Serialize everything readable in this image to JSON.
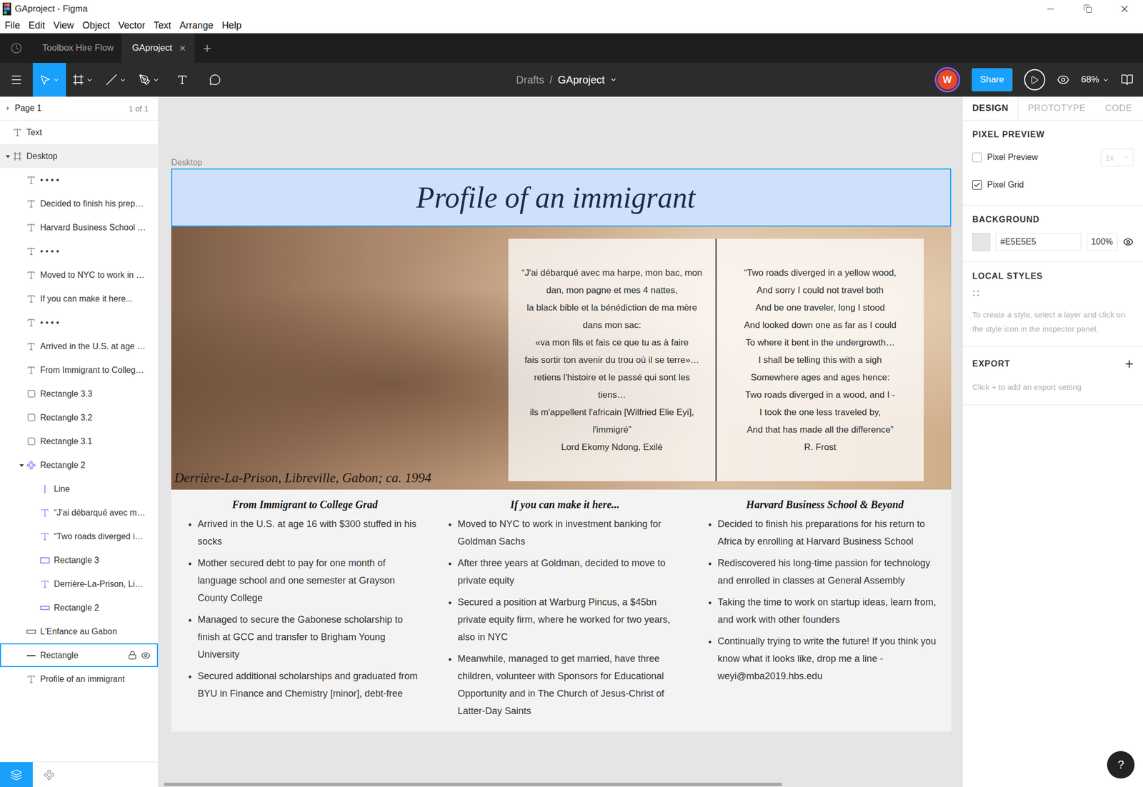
{
  "window": {
    "title": "GAproject - Figma"
  },
  "menu": [
    "File",
    "Edit",
    "View",
    "Object",
    "Vector",
    "Text",
    "Arrange",
    "Help"
  ],
  "tabs": [
    {
      "label": "Toolbox Hire Flow",
      "selected": false,
      "close": ""
    },
    {
      "label": "GAproject",
      "selected": true,
      "close": "×"
    }
  ],
  "new_tab": "+",
  "toolbar": {
    "tools": [
      {
        "kind": "move",
        "selected": true,
        "menu": true
      },
      {
        "kind": "frame",
        "selected": false,
        "menu": true
      },
      {
        "kind": "line",
        "selected": false,
        "menu": true
      },
      {
        "kind": "pen",
        "selected": false,
        "menu": true
      },
      {
        "kind": "text",
        "selected": false,
        "menu": false
      },
      {
        "kind": "comment",
        "selected": false,
        "menu": false
      }
    ],
    "breadcrumb": {
      "parent": "Drafts",
      "separator": "/",
      "file": "GAproject"
    },
    "user": {
      "initial": "W"
    },
    "share": "Share",
    "zoom": "68%"
  },
  "layers_panel": {
    "page": {
      "name": "Page 1",
      "count": "1 of 1",
      "expanded": false
    },
    "layers": [
      {
        "name": "Text",
        "kind": "text",
        "depth": 0,
        "selected": false,
        "hovered": false,
        "in_component": false
      },
      {
        "name": "Desktop",
        "kind": "frame",
        "depth": 0,
        "expanded": true,
        "selected": false,
        "hovered": true,
        "in_component": false
      },
      {
        "name": "• • • •",
        "kind": "text",
        "depth": 1,
        "selected": false,
        "hovered": false,
        "in_component": false
      },
      {
        "name": "Decided to finish his prep…",
        "kind": "text",
        "depth": 1,
        "selected": false,
        "hovered": false,
        "in_component": false
      },
      {
        "name": "Harvard Business School …",
        "kind": "text",
        "depth": 1,
        "selected": false,
        "hovered": false,
        "in_component": false
      },
      {
        "name": "• • • •",
        "kind": "text",
        "depth": 1,
        "selected": false,
        "hovered": false,
        "in_component": false
      },
      {
        "name": "Moved to NYC to work in …",
        "kind": "text",
        "depth": 1,
        "selected": false,
        "hovered": false,
        "in_component": false
      },
      {
        "name": "If you can make it here...",
        "kind": "text",
        "depth": 1,
        "selected": false,
        "hovered": false,
        "in_component": false
      },
      {
        "name": "• • • •",
        "kind": "text",
        "depth": 1,
        "selected": false,
        "hovered": false,
        "in_component": false
      },
      {
        "name": "Arrived in the U.S. at age …",
        "kind": "text",
        "depth": 1,
        "selected": false,
        "hovered": false,
        "in_component": false
      },
      {
        "name": "From Immigrant to Colleg…",
        "kind": "text",
        "depth": 1,
        "selected": false,
        "hovered": false,
        "in_component": false
      },
      {
        "name": "Rectangle 3.3",
        "kind": "rect",
        "depth": 1,
        "selected": false,
        "hovered": false,
        "in_component": false
      },
      {
        "name": "Rectangle 3.2",
        "kind": "rect",
        "depth": 1,
        "selected": false,
        "hovered": false,
        "in_component": false
      },
      {
        "name": "Rectangle 3.1",
        "kind": "rect",
        "depth": 1,
        "selected": false,
        "hovered": false,
        "in_component": false
      },
      {
        "name": "Rectangle 2",
        "kind": "component",
        "depth": 1,
        "expanded": true,
        "selected": false,
        "hovered": false,
        "in_component": true
      },
      {
        "name": "Line",
        "kind": "vline",
        "depth": 2,
        "selected": false,
        "hovered": false,
        "in_component": true
      },
      {
        "name": "“J'ai débarqué avec m…",
        "kind": "text",
        "depth": 2,
        "selected": false,
        "hovered": false,
        "in_component": true
      },
      {
        "name": "“Two roads diverged i…",
        "kind": "text",
        "depth": 2,
        "selected": false,
        "hovered": false,
        "in_component": true
      },
      {
        "name": "Rectangle 3",
        "kind": "wide-rect",
        "depth": 2,
        "selected": false,
        "hovered": false,
        "in_component": true
      },
      {
        "name": "Derrière-La-Prison, Li…",
        "kind": "text",
        "depth": 2,
        "selected": false,
        "hovered": false,
        "in_component": true
      },
      {
        "name": "Rectangle 2",
        "kind": "flat-rect",
        "depth": 2,
        "selected": false,
        "hovered": false,
        "in_component": true
      },
      {
        "name": "L'Enfance au Gabon",
        "kind": "flat-rect",
        "depth": 1,
        "selected": false,
        "hovered": false,
        "in_component": false
      },
      {
        "name": "Rectangle",
        "kind": "hline",
        "depth": 1,
        "selected": true,
        "hovered": false,
        "in_component": false
      },
      {
        "name": "Profile of an immigrant",
        "kind": "text",
        "depth": 1,
        "selected": false,
        "hovered": false,
        "in_component": false
      }
    ],
    "bottom_tabs": [
      {
        "kind": "layers",
        "selected": true
      },
      {
        "kind": "assets",
        "selected": false
      }
    ]
  },
  "canvas": {
    "frame_label": "Desktop",
    "artboard": {
      "title": "Profile of an immigrant",
      "caption": "Derrière-La-Prison, Libreville, Gabon; ca. 1994",
      "quotes": [
        {
          "lines": [
            "“J'ai débarqué avec ma harpe, mon bac, mon",
            "dan, mon pagne et mes 4 nattes,",
            "la black bible et la bénédiction de ma mère",
            "dans mon sac:",
            "«va mon fils et fais ce que tu as à faire",
            "fais sortir ton avenir du trou où il se terre»…",
            "retiens l'histoire et le passé qui sont les",
            "tiens…",
            "ils m'appellent l'africain [Wilfried Elie Eyi],",
            "l'immigré”",
            "Lord Ekomy Ndong, Exilé"
          ]
        },
        {
          "lines": [
            "“Two roads diverged in a yellow wood,",
            "And sorry I could not travel both",
            "And be one traveler, long I stood",
            "And looked down one as far as I could",
            "To where it bent in the undergrowth…",
            "I shall be telling this with a sigh",
            "Somewhere ages and ages hence:",
            "Two roads diverged in a wood, and I -",
            "I took the one less traveled by,",
            "And that has made all the difference”",
            "R. Frost"
          ]
        }
      ],
      "columns": [
        {
          "heading": "From Immigrant to College Grad",
          "bullets": [
            "Arrived in the U.S. at age 16 with $300 stuffed in his socks",
            "Mother secured debt to pay for one month of language school and one semester at Grayson County College",
            "Managed to secure the Gabonese scholarship to finish at GCC and transfer to Brigham Young University",
            "Secured additional scholarships and graduated from BYU in Finance and Chemistry [minor], debt-free"
          ]
        },
        {
          "heading": "If you can make it here...",
          "bullets": [
            "Moved to NYC to work in investment banking for Goldman Sachs",
            "After three years at Goldman, decided to move to private equity",
            "Secured a position at Warburg Pincus, a $45bn private equity firm, where he worked for two years, also in NYC",
            "Meanwhile, managed to get married, have three children, volunteer with Sponsors for Educational Opportunity and in The Church of Jesus-Christ of Latter-Day Saints"
          ]
        },
        {
          "heading": "Harvard Business School & Beyond",
          "bullets": [
            "Decided to finish his preparations for his return to Africa by enrolling at Harvard Business School",
            "Rediscovered his long-time passion for technology and enrolled in classes at General Assembly",
            "Taking the time to work on startup ideas, learn from, and work with other founders",
            "Continually trying to write the future! If you think you know what it looks like, drop me a line - weyi@mba2019.hbs.edu"
          ]
        }
      ]
    }
  },
  "design_panel": {
    "tabs": [
      {
        "label": "DESIGN",
        "selected": true
      },
      {
        "label": "PROTOTYPE",
        "selected": false
      },
      {
        "label": "CODE",
        "selected": false
      }
    ],
    "pixel_preview": {
      "title": "PIXEL PREVIEW",
      "options": [
        {
          "label": "Pixel Preview",
          "checked": false
        },
        {
          "label": "Pixel Grid",
          "checked": true
        }
      ],
      "scale": "1x",
      "scale_disabled": true
    },
    "background": {
      "title": "BACKGROUND",
      "hex": "#E5E5E5",
      "opacity": "100%",
      "color": "#E5E5E5"
    },
    "local_styles": {
      "title": "LOCAL STYLES",
      "hint": "To create a style, select a layer and click on the style icon in the inspector panel."
    },
    "export": {
      "title": "EXPORT",
      "add": "+",
      "hint": "Click + to add an export setting"
    }
  },
  "help": "?"
}
